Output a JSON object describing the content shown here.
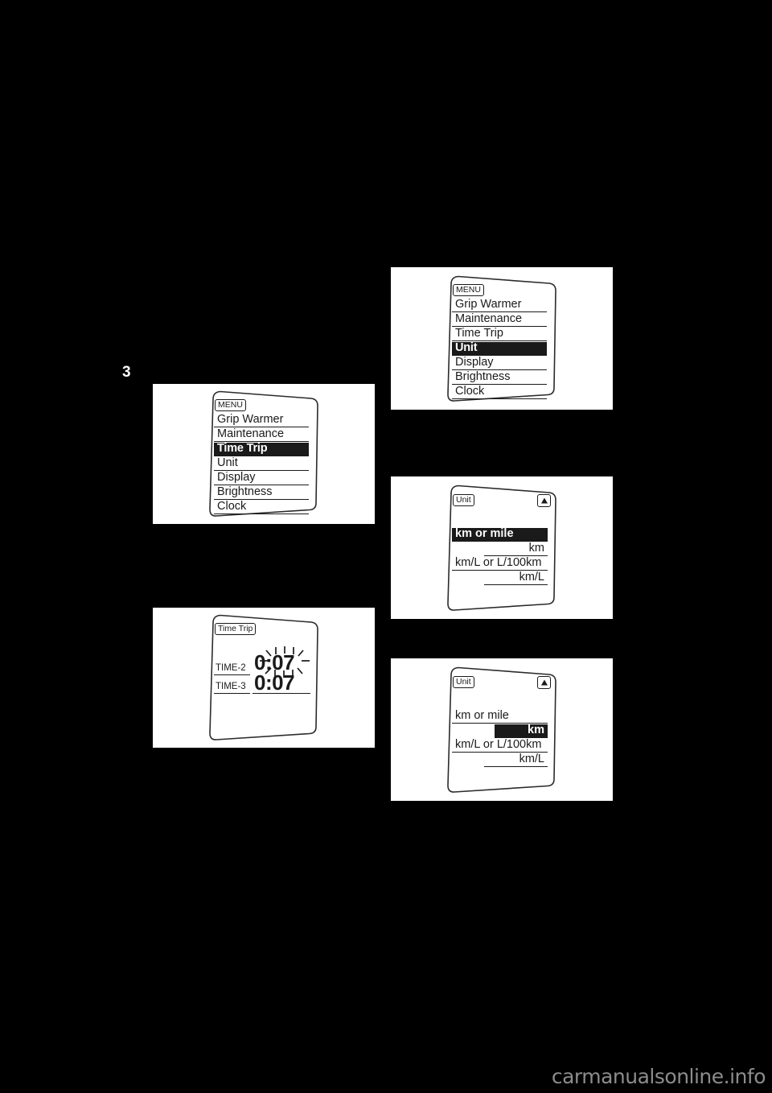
{
  "page": {
    "chapter_number": "3",
    "watermark": "carmanualsonline.info",
    "background_color": "#000000",
    "plate_color": "#ffffff",
    "ink_color": "#1a1a1a"
  },
  "figures": [
    {
      "id": "menu-time-trip",
      "type": "menu",
      "header_tag": "MENU",
      "items": [
        {
          "label": "Grip Warmer",
          "selected": false
        },
        {
          "label": "Maintenance",
          "selected": false
        },
        {
          "label": "Time Trip",
          "selected": true
        },
        {
          "label": "Unit",
          "selected": false
        },
        {
          "label": "Display",
          "selected": false
        },
        {
          "label": "Brightness",
          "selected": false
        },
        {
          "label": "Clock",
          "selected": false
        }
      ]
    },
    {
      "id": "time-trip-screen",
      "type": "time-trip",
      "header_tag": "Time Trip",
      "rows": [
        {
          "label": "TIME-2",
          "value": "0:07",
          "blinking": true
        },
        {
          "label": "TIME-3",
          "value": "0:07",
          "blinking": false
        }
      ]
    },
    {
      "id": "menu-unit",
      "type": "menu",
      "header_tag": "MENU",
      "items": [
        {
          "label": "Grip Warmer",
          "selected": false
        },
        {
          "label": "Maintenance",
          "selected": false
        },
        {
          "label": "Time Trip",
          "selected": false
        },
        {
          "label": "Unit",
          "selected": true
        },
        {
          "label": "Display",
          "selected": false
        },
        {
          "label": "Brightness",
          "selected": false
        },
        {
          "label": "Clock",
          "selected": false
        }
      ]
    },
    {
      "id": "unit-screen-setting-selected",
      "type": "unit",
      "header_tag": "Unit",
      "arrow_icon": "up-triangle-icon",
      "rows": [
        {
          "label": "km or mile",
          "align": "left",
          "selected": true
        },
        {
          "label": "km",
          "align": "right",
          "selected": false
        },
        {
          "label": "km/L or L/100km",
          "align": "left",
          "selected": false
        },
        {
          "label": "km/L",
          "align": "right",
          "selected": false
        }
      ]
    },
    {
      "id": "unit-screen-value-selected",
      "type": "unit",
      "header_tag": "Unit",
      "arrow_icon": "up-triangle-icon",
      "rows": [
        {
          "label": "km or mile",
          "align": "left",
          "selected": false
        },
        {
          "label": "km",
          "align": "right",
          "selected": true
        },
        {
          "label": "km/L or L/100km",
          "align": "left",
          "selected": false
        },
        {
          "label": "km/L",
          "align": "right",
          "selected": false
        }
      ]
    }
  ]
}
